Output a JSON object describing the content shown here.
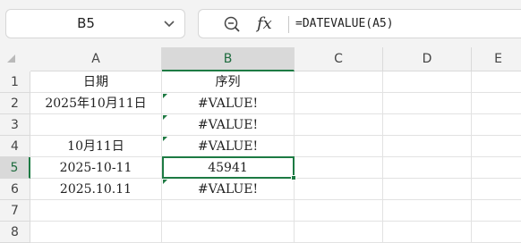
{
  "name_box": {
    "value": "B5"
  },
  "formula_bar": {
    "fx_label": "fx",
    "formula": "=DATEVALUE(A5)"
  },
  "columns": [
    "A",
    "B",
    "C",
    "D",
    "E"
  ],
  "selected_column": "B",
  "rows": [
    {
      "num": "1",
      "a": "日期",
      "b": "序列",
      "b_error_marker": false
    },
    {
      "num": "2",
      "a": "2025年10月11日",
      "b": "#VALUE!",
      "b_error_marker": true
    },
    {
      "num": "3",
      "a": "",
      "b": "#VALUE!",
      "b_error_marker": true
    },
    {
      "num": "4",
      "a": "10月11日",
      "b": "#VALUE!",
      "b_error_marker": true
    },
    {
      "num": "5",
      "a": "2025-10-11",
      "b": "45941",
      "b_error_marker": false
    },
    {
      "num": "6",
      "a": "2025.10.11",
      "b": "#VALUE!",
      "b_error_marker": true
    },
    {
      "num": "7",
      "a": "",
      "b": "",
      "b_error_marker": false
    },
    {
      "num": "8",
      "a": "",
      "b": "",
      "b_error_marker": false
    }
  ],
  "selected_row": "5",
  "colors": {
    "accent": "#1d7a43",
    "error_marker": "#1f7a43",
    "header_bg": "#f3f3f3"
  },
  "icons": {
    "name_box_dropdown": "chevron-down-icon",
    "zoom": "zoom-icon",
    "function": "fx-icon",
    "select_all": "select-all-triangle-icon"
  }
}
